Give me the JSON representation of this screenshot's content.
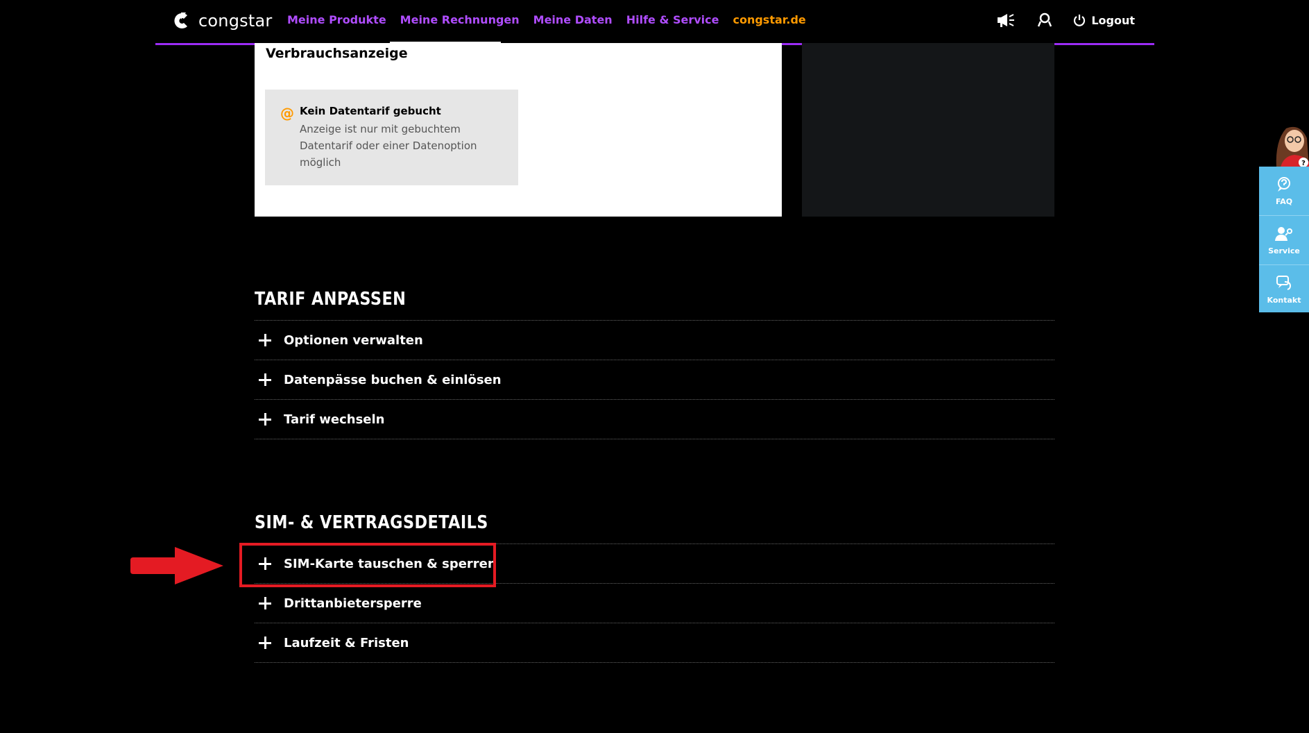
{
  "header": {
    "logo_text": "congstar",
    "nav": [
      {
        "label": "Meine Produkte"
      },
      {
        "label": "Meine Rechnungen"
      },
      {
        "label": "Meine Daten"
      },
      {
        "label": "Hilfe & Service"
      },
      {
        "label": "congstar.de"
      }
    ],
    "logout_label": "Logout"
  },
  "usage": {
    "title": "Verbrauchsanzeige",
    "info_title": "Kein Datentarif gebucht",
    "info_text": "Anzeige ist nur mit gebuchtem Datentarif oder einer Datenoption möglich"
  },
  "tarif": {
    "title": "TARIF ANPASSEN",
    "items": [
      {
        "label": "Optionen verwalten"
      },
      {
        "label": "Datenpässe buchen & einlösen"
      },
      {
        "label": "Tarif wechseln"
      }
    ]
  },
  "sim": {
    "title": "SIM- & VERTRAGSDETAILS",
    "items": [
      {
        "label": "SIM-Karte tauschen & sperren"
      },
      {
        "label": "Drittanbietersperre"
      },
      {
        "label": "Laufzeit & Fristen"
      }
    ]
  },
  "side_widget": {
    "items": [
      {
        "label": "FAQ",
        "icon": "faq-icon"
      },
      {
        "label": "Service",
        "icon": "service-icon"
      },
      {
        "label": "Kontakt",
        "icon": "kontakt-icon"
      }
    ]
  },
  "colors": {
    "nav_purple": "#b04dff",
    "nav_orange": "#ff9a00",
    "highlight_red": "#e41b23",
    "widget_blue": "#5bbde9"
  }
}
